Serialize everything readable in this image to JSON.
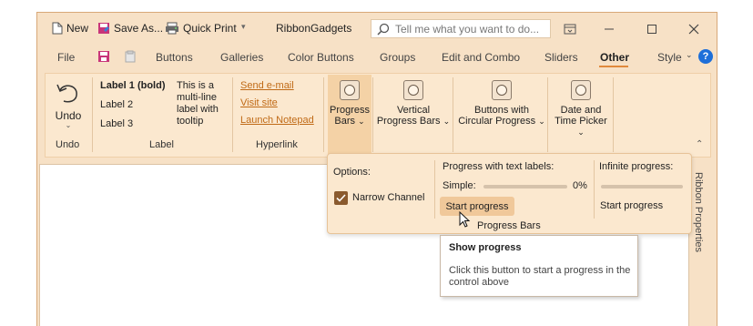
{
  "qat": {
    "new": "New",
    "save_as": "Save As...",
    "quick_print": "Quick Print"
  },
  "title": "RibbonGadgets",
  "search": {
    "placeholder": "Tell me what you want to do..."
  },
  "tabs": [
    "File",
    "Buttons",
    "Galleries",
    "Color Buttons",
    "Groups",
    "Edit and Combo",
    "Sliders",
    "Other",
    "Style"
  ],
  "active_tab": "Other",
  "groups": {
    "undo": {
      "button": "Undo",
      "label": "Undo"
    },
    "label": {
      "label1": "Label 1 (bold)",
      "label2": "Label 2",
      "label3": "Label 3",
      "multiline": [
        "This is a",
        "multi-line",
        "label with",
        "tooltip"
      ],
      "label": "Label"
    },
    "hyperlink": {
      "links": [
        "Send e-mail",
        "Visit site",
        "Launch Notepad"
      ],
      "label": "Hyperlink"
    },
    "gallery": {
      "progress_bars": [
        "Progress",
        "Bars"
      ],
      "vertical": [
        "Vertical",
        "Progress Bars"
      ],
      "circular": [
        "Buttons with",
        "Circular Progress"
      ],
      "datetime": [
        "Date and",
        "Time Picker"
      ]
    }
  },
  "popup": {
    "options_label": "Options:",
    "narrow_channel": "Narrow Channel",
    "narrow_checked": true,
    "text_labels_header": "Progress with text labels:",
    "simple_label": "Simple:",
    "simple_percent": "0%",
    "simple_progress": 0,
    "start_progress": "Start progress",
    "infinite_header": "Infinite progress:",
    "infinite_start": "Start progress",
    "caption": "Progress Bars"
  },
  "tooltip": {
    "title": "Show progress",
    "body": "Click this button to start a progress in the control above"
  },
  "side_panel": "Ribbon Properties",
  "colors": {
    "accent": "#e08a3c",
    "ribbon_bg": "#fbe8cf",
    "frame": "#f7e1c6",
    "help": "#1e6fd9"
  }
}
